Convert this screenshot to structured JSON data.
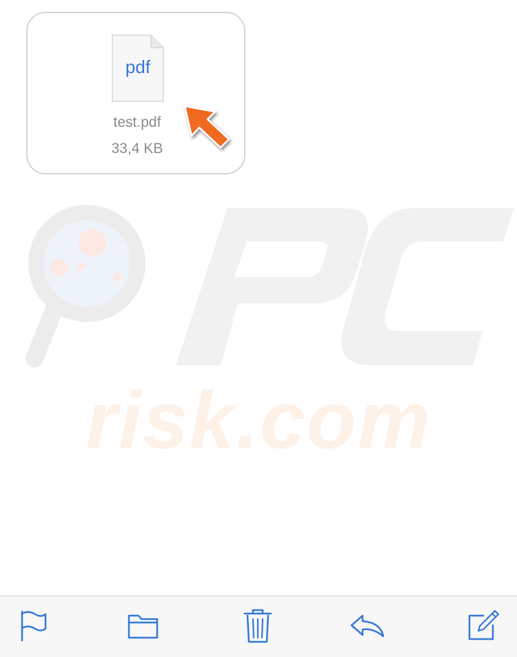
{
  "attachment": {
    "icon": "pdf-file-icon",
    "icon_label": "pdf",
    "file_name": "test.pdf",
    "file_size": "33,4 KB"
  },
  "watermark": {
    "text": "risk.com",
    "logo_lettering": "PC"
  },
  "toolbar": {
    "items": [
      {
        "name": "flag-button",
        "icon": "flag-icon"
      },
      {
        "name": "move-to-folder-button",
        "icon": "folder-icon"
      },
      {
        "name": "trash-button",
        "icon": "trash-icon"
      },
      {
        "name": "reply-button",
        "icon": "reply-icon"
      },
      {
        "name": "compose-button",
        "icon": "compose-icon"
      }
    ]
  },
  "colors": {
    "accent": "#3478d6",
    "arrow": "#f06a23",
    "secondary_text": "#8a8a8a",
    "card_border": "#d4d4d4",
    "toolbar_background": "#f7f7f7"
  }
}
